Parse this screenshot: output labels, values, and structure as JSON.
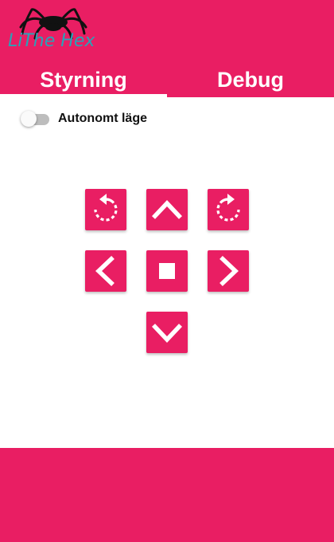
{
  "app": {
    "logo_text": "LiThe Hex",
    "colors": {
      "primary": "#e91e63",
      "logo_text": "#29a3b8",
      "spider": "#111111",
      "background": "#ffffff"
    }
  },
  "tabs": [
    {
      "label": "Styrning",
      "selected": true
    },
    {
      "label": "Debug",
      "selected": false
    }
  ],
  "autonomous_toggle": {
    "label": "Autonomt läge",
    "on": false
  },
  "controls": {
    "rotate_left": "rotate-ccw-icon",
    "forward": "chevron-up-icon",
    "rotate_right": "rotate-cw-icon",
    "left": "chevron-left-icon",
    "stop": "stop-icon",
    "right": "chevron-right-icon",
    "backward": "chevron-down-icon"
  }
}
